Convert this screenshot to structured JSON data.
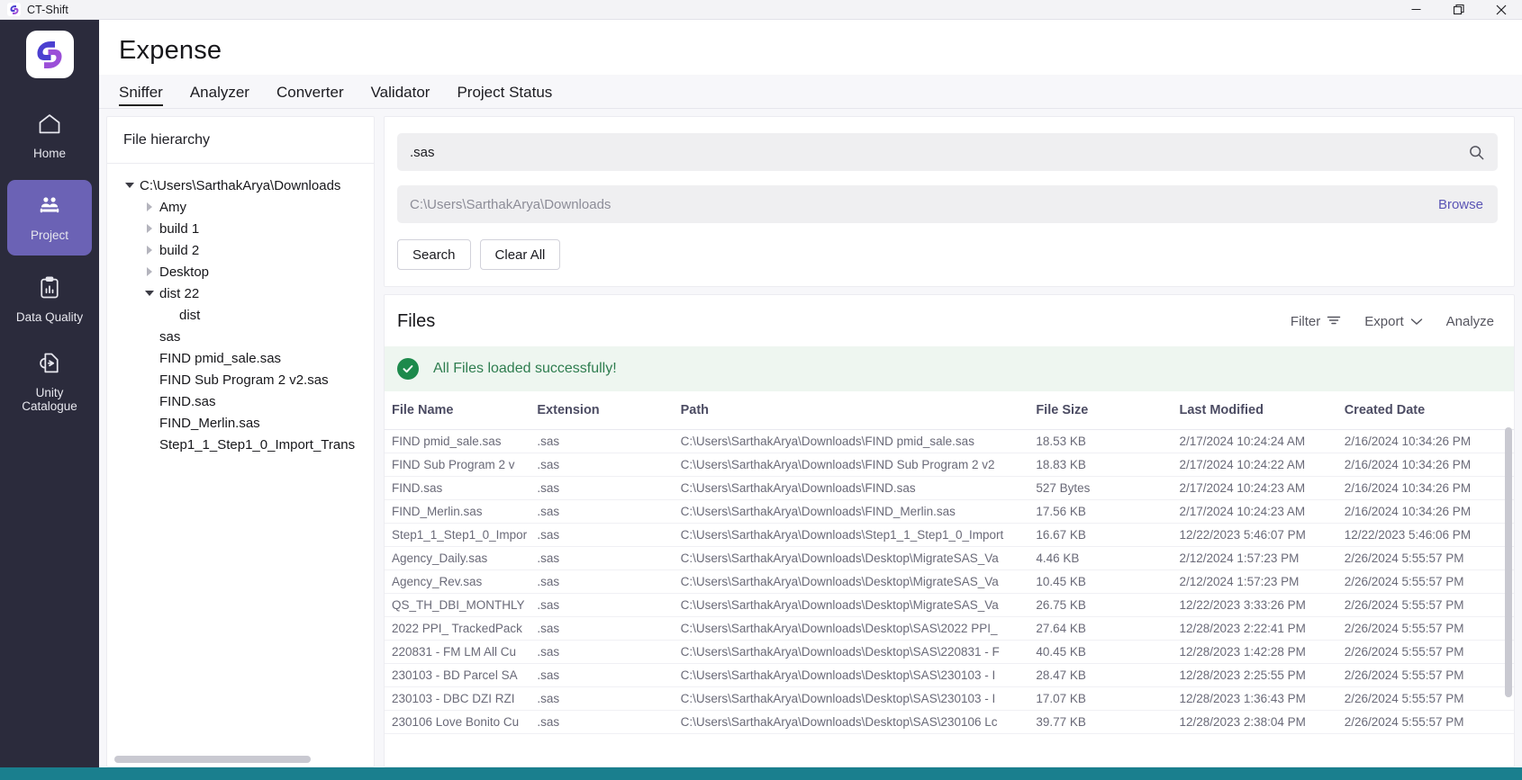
{
  "window": {
    "app_title": "CT-Shift",
    "minimize_label": "─",
    "maximize_label": "❐",
    "close_label": "✕"
  },
  "rail": {
    "items": [
      {
        "label": "Home",
        "icon": "home-icon",
        "active": false
      },
      {
        "label": "Project",
        "icon": "users-icon",
        "active": true
      },
      {
        "label": "Data Quality",
        "icon": "clipboard-chart-icon",
        "active": false
      },
      {
        "label": "Unity Catalogue",
        "icon": "file-sync-icon",
        "active": false
      }
    ]
  },
  "header": {
    "title": "Expense"
  },
  "tabs": [
    {
      "label": "Sniffer",
      "active": true
    },
    {
      "label": "Analyzer",
      "active": false
    },
    {
      "label": "Converter",
      "active": false
    },
    {
      "label": "Validator",
      "active": false
    },
    {
      "label": "Project Status",
      "active": false
    }
  ],
  "hierarchy": {
    "title": "File hierarchy",
    "nodes": [
      {
        "label": "C:\\Users\\SarthakArya\\Downloads",
        "indent": 0,
        "toggle": "down"
      },
      {
        "label": "Amy",
        "indent": 1,
        "toggle": "right"
      },
      {
        "label": "build 1",
        "indent": 1,
        "toggle": "right"
      },
      {
        "label": "build 2",
        "indent": 1,
        "toggle": "right"
      },
      {
        "label": "Desktop",
        "indent": 1,
        "toggle": "right"
      },
      {
        "label": "dist 22",
        "indent": 1,
        "toggle": "down"
      },
      {
        "label": "dist",
        "indent": 2,
        "toggle": "none"
      },
      {
        "label": "sas",
        "indent": 1,
        "toggle": "none"
      },
      {
        "label": "FIND pmid_sale.sas",
        "indent": 1,
        "toggle": "none"
      },
      {
        "label": "FIND Sub Program 2 v2.sas",
        "indent": 1,
        "toggle": "none"
      },
      {
        "label": "FIND.sas",
        "indent": 1,
        "toggle": "none"
      },
      {
        "label": "FIND_Merlin.sas",
        "indent": 1,
        "toggle": "none"
      },
      {
        "label": "Step1_1_Step1_0_Import_Trans",
        "indent": 1,
        "toggle": "none"
      }
    ]
  },
  "search": {
    "query_value": ".sas",
    "query_placeholder": "",
    "search_icon": "search-icon",
    "path_value": "",
    "path_placeholder": "C:\\Users\\SarthakArya\\Downloads",
    "browse_label": "Browse",
    "search_button": "Search",
    "clear_button": "Clear All"
  },
  "files": {
    "title": "Files",
    "filter_label": "Filter",
    "export_label": "Export",
    "analyze_label": "Analyze",
    "banner_text": "All Files loaded successfully!",
    "columns": [
      "File Name",
      "Extension",
      "Path",
      "File Size",
      "Last Modified",
      "Created Date"
    ],
    "rows": [
      {
        "name": "FIND pmid_sale.sas",
        "ext": ".sas",
        "path": "C:\\Users\\SarthakArya\\Downloads\\FIND pmid_sale.sas",
        "size": "18.53 KB",
        "modified": "2/17/2024 10:24:24 AM",
        "created": "2/16/2024 10:34:26 PM"
      },
      {
        "name": "FIND Sub Program 2 v",
        "ext": ".sas",
        "path": "C:\\Users\\SarthakArya\\Downloads\\FIND Sub Program 2 v2",
        "size": "18.83 KB",
        "modified": "2/17/2024 10:24:22 AM",
        "created": "2/16/2024 10:34:26 PM"
      },
      {
        "name": "FIND.sas",
        "ext": ".sas",
        "path": "C:\\Users\\SarthakArya\\Downloads\\FIND.sas",
        "size": "527 Bytes",
        "modified": "2/17/2024 10:24:23 AM",
        "created": "2/16/2024 10:34:26 PM"
      },
      {
        "name": "FIND_Merlin.sas",
        "ext": ".sas",
        "path": "C:\\Users\\SarthakArya\\Downloads\\FIND_Merlin.sas",
        "size": "17.56 KB",
        "modified": "2/17/2024 10:24:23 AM",
        "created": "2/16/2024 10:34:26 PM"
      },
      {
        "name": "Step1_1_Step1_0_Impor",
        "ext": ".sas",
        "path": "C:\\Users\\SarthakArya\\Downloads\\Step1_1_Step1_0_Import",
        "size": "16.67 KB",
        "modified": "12/22/2023 5:46:07 PM",
        "created": "12/22/2023 5:46:06 PM"
      },
      {
        "name": "Agency_Daily.sas",
        "ext": ".sas",
        "path": "C:\\Users\\SarthakArya\\Downloads\\Desktop\\MigrateSAS_Va",
        "size": "4.46 KB",
        "modified": "2/12/2024 1:57:23 PM",
        "created": "2/26/2024 5:55:57 PM"
      },
      {
        "name": "Agency_Rev.sas",
        "ext": ".sas",
        "path": "C:\\Users\\SarthakArya\\Downloads\\Desktop\\MigrateSAS_Va",
        "size": "10.45 KB",
        "modified": "2/12/2024 1:57:23 PM",
        "created": "2/26/2024 5:55:57 PM"
      },
      {
        "name": "QS_TH_DBI_MONTHLY",
        "ext": ".sas",
        "path": "C:\\Users\\SarthakArya\\Downloads\\Desktop\\MigrateSAS_Va",
        "size": "26.75 KB",
        "modified": "12/22/2023 3:33:26 PM",
        "created": "2/26/2024 5:55:57 PM"
      },
      {
        "name": "2022 PPI_ TrackedPack",
        "ext": ".sas",
        "path": "C:\\Users\\SarthakArya\\Downloads\\Desktop\\SAS\\2022 PPI_",
        "size": "27.64 KB",
        "modified": "12/28/2023 2:22:41 PM",
        "created": "2/26/2024 5:55:57 PM"
      },
      {
        "name": "220831 - FM LM All Cu",
        "ext": ".sas",
        "path": "C:\\Users\\SarthakArya\\Downloads\\Desktop\\SAS\\220831 - F",
        "size": "40.45 KB",
        "modified": "12/28/2023 1:42:28 PM",
        "created": "2/26/2024 5:55:57 PM"
      },
      {
        "name": "230103 - BD Parcel SA",
        "ext": ".sas",
        "path": "C:\\Users\\SarthakArya\\Downloads\\Desktop\\SAS\\230103 - I",
        "size": "28.47 KB",
        "modified": "12/28/2023 2:25:55 PM",
        "created": "2/26/2024 5:55:57 PM"
      },
      {
        "name": "230103 - DBC DZI RZI",
        "ext": ".sas",
        "path": "C:\\Users\\SarthakArya\\Downloads\\Desktop\\SAS\\230103 - I",
        "size": "17.07 KB",
        "modified": "12/28/2023 1:36:43 PM",
        "created": "2/26/2024 5:55:57 PM"
      },
      {
        "name": "230106 Love Bonito Cu",
        "ext": ".sas",
        "path": "C:\\Users\\SarthakArya\\Downloads\\Desktop\\SAS\\230106 Lc",
        "size": "39.77 KB",
        "modified": "12/28/2023 2:38:04 PM",
        "created": "2/26/2024 5:55:57 PM"
      }
    ]
  },
  "colors": {
    "rail_bg": "#2b2b3c",
    "accent": "#6b62b5",
    "link": "#5b55b5",
    "success": "#1d8a4c",
    "status_bar": "#1a7f8e"
  }
}
